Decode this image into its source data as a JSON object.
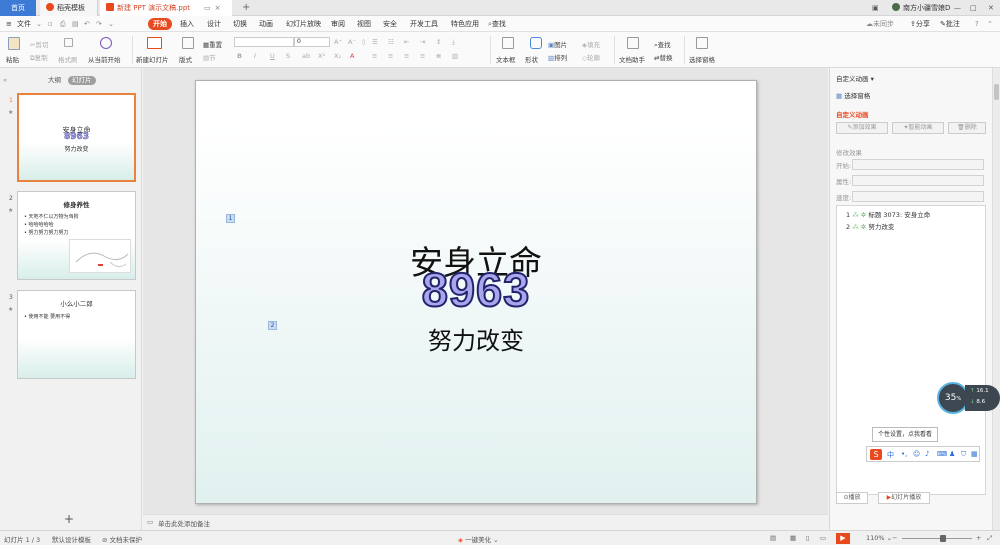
{
  "tabs": {
    "home": "首页",
    "template": "稻壳模板",
    "doc": "新建 PPT 演示文稿.ppt"
  },
  "titlebar": {
    "user": "南方小疆雪娘D"
  },
  "menu": {
    "file": "文件",
    "items": [
      "开始",
      "插入",
      "设计",
      "切换",
      "动画",
      "幻灯片放映",
      "审阅",
      "视图",
      "安全",
      "开发工具",
      "特色应用"
    ],
    "search": "查找",
    "sync": "未同步",
    "share": "分享",
    "comment": "批注"
  },
  "ribbon": {
    "paste": "粘贴",
    "cut": "剪切",
    "copy": "复制",
    "format": "格式刷",
    "from_current": "从当前开始",
    "new_slide": "新建幻灯片",
    "layout": "版式",
    "reset": "重置",
    "section": "节",
    "font_size": "0",
    "textbox": "文本框",
    "shape": "形状",
    "arrange": "排列",
    "picture": "图片",
    "fill": "填充",
    "outline": "轮廓",
    "doc_helper": "文档助手",
    "find": "查找",
    "replace": "替换",
    "select_pane": "选择窗格"
  },
  "left_panel": {
    "outline_tab": "大纲",
    "slides_tab": "幻灯片",
    "thumbs": [
      {
        "num": "1",
        "title": "安身立命",
        "big": "8963",
        "sub": "努力改变"
      },
      {
        "num": "2",
        "title": "修身养性",
        "bullets": [
          "天地不仁以万物为刍狗",
          "哈哈哈哈哈",
          "努力努力努力努力"
        ]
      },
      {
        "num": "3",
        "title": "小么小二郎",
        "bullets": [
          "使用不能 要用不得"
        ]
      }
    ]
  },
  "slide": {
    "title": "安身立命",
    "number": "8963",
    "subtitle": "努力改变",
    "anim_tags": [
      "1",
      "2"
    ]
  },
  "notes": {
    "placeholder": "单击此处添加备注"
  },
  "right_panel": {
    "header": "自定义动画",
    "select_pane": "选择窗格",
    "section": "自定义动画",
    "add_effect": "添加效果",
    "smart_anim": "智能动画",
    "delete": "删除",
    "modify": "修改效果",
    "start_label": "开始:",
    "prop_label": "属性:",
    "speed_label": "速度:",
    "list": [
      {
        "n": "1",
        "text": "标题 3073: 安身立命"
      },
      {
        "n": "2",
        "text": "努力改变"
      }
    ],
    "play": "播放",
    "slideshow": "幻灯片播放"
  },
  "widget": {
    "percent": "35",
    "up": "16.1",
    "down": "8.6",
    "tooltip": "个性设置，点我看看"
  },
  "status": {
    "slide_info": "幻灯片 1 / 3",
    "template": "默认设计模板",
    "protect": "文档未保护",
    "beautify": "一键美化",
    "zoom": "110%"
  }
}
